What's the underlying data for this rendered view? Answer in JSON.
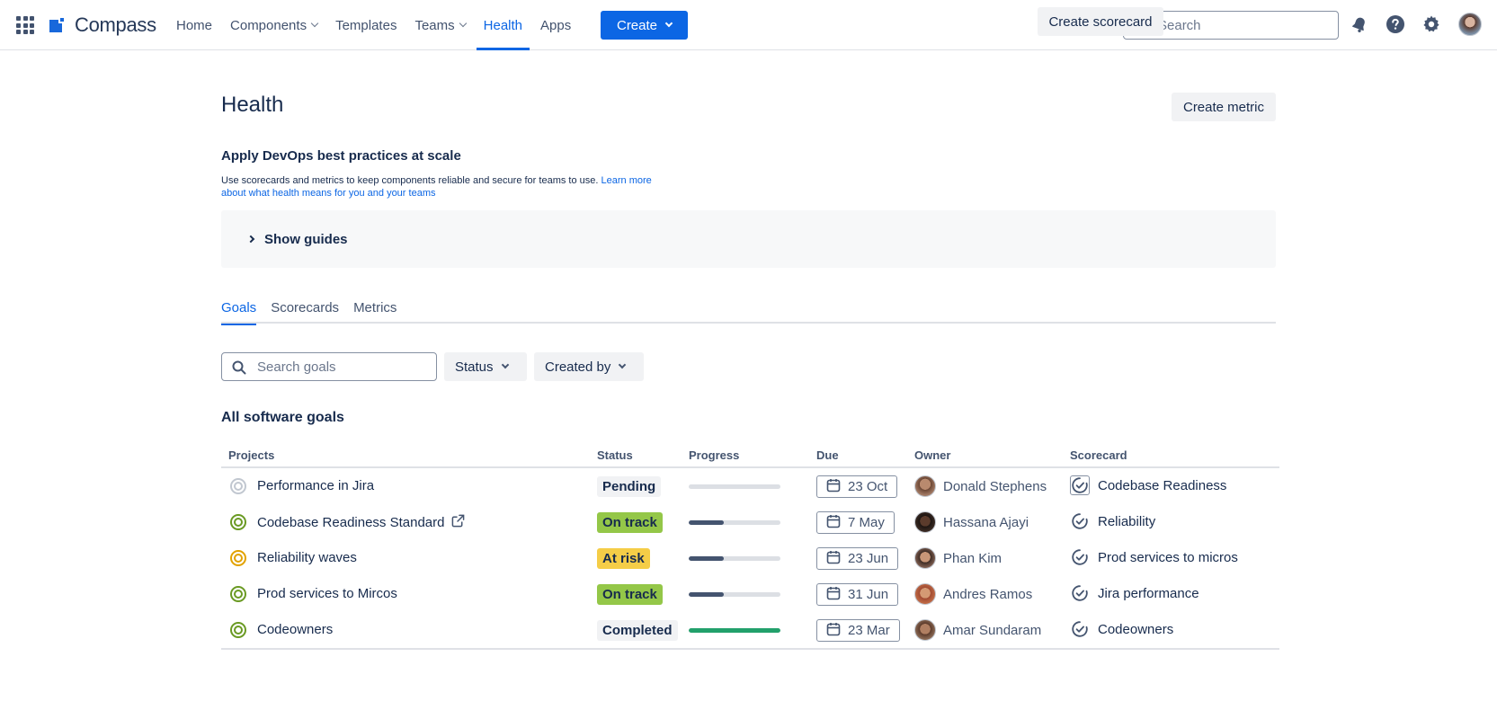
{
  "nav": {
    "logo": "Compass",
    "items": [
      {
        "label": "Home",
        "dropdown": false,
        "active": false
      },
      {
        "label": "Components",
        "dropdown": true,
        "active": false
      },
      {
        "label": "Templates",
        "dropdown": false,
        "active": false
      },
      {
        "label": "Teams",
        "dropdown": true,
        "active": false
      },
      {
        "label": "Health",
        "dropdown": false,
        "active": true
      },
      {
        "label": "Apps",
        "dropdown": false,
        "active": false
      }
    ],
    "create_label": "Create",
    "search_placeholder": "Search",
    "accent": "#0C66E4",
    "icons": [
      "app-switcher-icon",
      "notifications-icon",
      "help-icon",
      "settings-icon",
      "profile-avatar"
    ]
  },
  "header": {
    "title": "Health",
    "create_scorecard": "Create scorecard",
    "create_metric": "Create metric"
  },
  "intro": {
    "subtitle": "Apply DevOps best practices at scale",
    "description": "Use scorecards and metrics to keep components reliable and secure for teams to use.",
    "link": "Learn more about what health means for you and your teams",
    "guides_label": "Show guides"
  },
  "tabs": [
    {
      "label": "Goals",
      "active": true
    },
    {
      "label": "Scorecards",
      "active": false
    },
    {
      "label": "Metrics",
      "active": false
    }
  ],
  "filters": {
    "search_placeholder": "Search goals",
    "status": "Status",
    "created_by": "Created by"
  },
  "table": {
    "title": "All software goals",
    "columns": [
      "Projects",
      "Status",
      "Progress",
      "Due",
      "Owner",
      "Scorecard"
    ],
    "rows": [
      {
        "project": "Performance in Jira",
        "icon_state": "gray",
        "external": false,
        "status": "Pending",
        "status_kind": "pending",
        "progress": 0,
        "due": "23 Oct",
        "owner": "Donald Stephens",
        "scorecard": "Codebase Readiness",
        "scorecard_boxed": true
      },
      {
        "project": "Codebase Readiness Standard",
        "icon_state": "green",
        "external": true,
        "status": "On track",
        "status_kind": "ontrack",
        "progress": 0.38,
        "due": "7 May",
        "owner": "Hassana Ajayi",
        "scorecard": "Reliability",
        "scorecard_boxed": false
      },
      {
        "project": "Reliability waves",
        "icon_state": "amber",
        "external": false,
        "status": "At risk",
        "status_kind": "atrisk",
        "progress": 0.38,
        "due": "23 Jun",
        "owner": "Phan Kim",
        "scorecard": "Prod services to micros",
        "scorecard_boxed": false
      },
      {
        "project": "Prod services to Mircos",
        "icon_state": "green",
        "external": false,
        "status": "On track",
        "status_kind": "ontrack",
        "progress": 0.38,
        "due": "31 Jun",
        "owner": "Andres Ramos",
        "scorecard": "Jira performance",
        "scorecard_boxed": false
      },
      {
        "project": "Codeowners",
        "icon_state": "green",
        "external": false,
        "status": "Completed",
        "status_kind": "completed",
        "progress": 1,
        "due": "23 Mar",
        "owner": "Amar Sundaram",
        "scorecard": "Codeowners",
        "scorecard_boxed": false
      }
    ]
  }
}
